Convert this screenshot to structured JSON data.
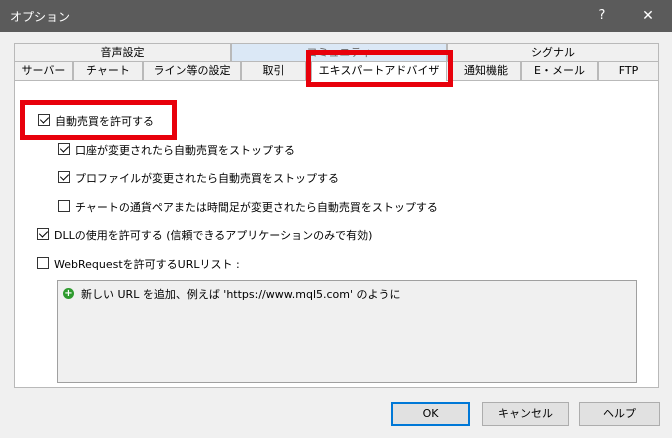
{
  "window": {
    "title": "オプション",
    "help_label": "?",
    "close_label": "✕"
  },
  "tabs": {
    "row_back": [
      "音声設定",
      "コミュニティ",
      "シグナル"
    ],
    "row_front": [
      "サーバー",
      "チャート",
      "ライン等の設定",
      "取引",
      "エキスパートアドバイザ",
      "通知機能",
      "E・メール",
      "FTP"
    ],
    "active": "エキスパートアドバイザ"
  },
  "options": {
    "auto_trading": {
      "label": "自動売買を許可する",
      "checked": true
    },
    "disable_on_account_change": {
      "label": "口座が変更されたら自動売買をストップする",
      "checked": true
    },
    "disable_on_profile_change": {
      "label": "プロファイルが変更されたら自動売買をストップする",
      "checked": true
    },
    "disable_on_symbol_change": {
      "label": "チャートの通貨ペアまたは時間足が変更されたら自動売買をストップする",
      "checked": false
    },
    "allow_dll": {
      "label": "DLLの使用を許可する (信頼できるアプリケーションのみで有効)",
      "checked": true
    },
    "allow_webrequest": {
      "label": "WebRequestを許可するURLリスト :",
      "checked": false
    }
  },
  "url_list": {
    "add_hint": "新しい URL を追加、例えば 'https://www.mql5.com' のように"
  },
  "buttons": {
    "ok": "OK",
    "cancel": "キャンセル",
    "help": "ヘルプ"
  },
  "colors": {
    "highlight_box": "#e8000b",
    "titlebar": "#5b5b5b",
    "add_icon": "#2e9b2e"
  }
}
